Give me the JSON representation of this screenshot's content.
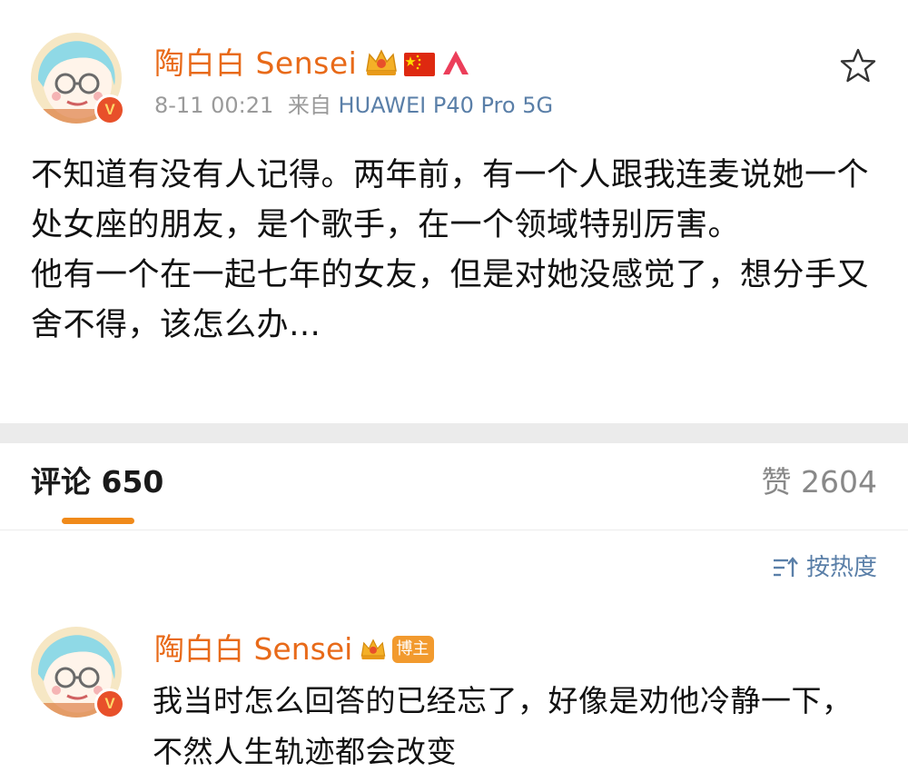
{
  "post": {
    "author": "陶白白 Sensei",
    "timestamp": "8-11 00:21",
    "source_prefix": "来自",
    "device": "HUAWEI P40 Pro 5G",
    "verified_badge": "V",
    "paragraphs": [
      "不知道有没有人记得。两年前，有一个人跟我连麦说她一个处女座的朋友，是个歌手，在一个领域特别厉害。",
      "他有一个在一起七年的女友，但是对她没感觉了，想分手又舍不得，该怎么办…"
    ],
    "icons": [
      "crown-icon",
      "china-flag-icon",
      "red-a-logo-icon",
      "star-outline-icon"
    ]
  },
  "tabs": {
    "comments_label": "评论 650",
    "likes_label": "赞 2604"
  },
  "sort": {
    "label": "按热度",
    "icon": "sort-icon"
  },
  "comment": {
    "author": "陶白白 Sensei",
    "badge": "博主",
    "verified_badge": "V",
    "text": "我当时怎么回答的已经忘了，好像是劝他冷静一下，不然人生轨迹都会改变"
  },
  "colors": {
    "username": "#e86a19",
    "link_blue": "#5a7fa8",
    "accent_orange": "#f08a1a",
    "verified_red": "#e8502a"
  }
}
